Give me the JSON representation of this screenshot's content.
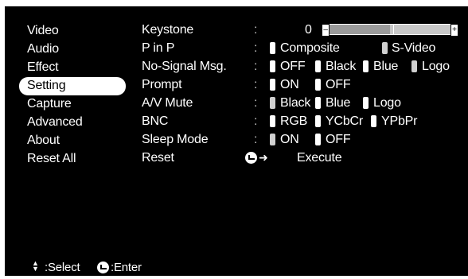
{
  "menu": {
    "items": [
      {
        "label": "Video"
      },
      {
        "label": "Audio"
      },
      {
        "label": "Effect"
      },
      {
        "label": "Setting",
        "selected": true
      },
      {
        "label": "Capture"
      },
      {
        "label": "Advanced"
      },
      {
        "label": "About"
      },
      {
        "label": "Reset All"
      }
    ]
  },
  "settings": {
    "keystone": {
      "label": "Keystone",
      "value": "0",
      "level_percent": 50
    },
    "pinp": {
      "label": "P in P",
      "options": [
        "Composite",
        "S-Video"
      ]
    },
    "no_signal": {
      "label": "No-Signal Msg.",
      "options": [
        "OFF",
        "Black",
        "Blue",
        "Logo"
      ]
    },
    "prompt": {
      "label": "Prompt",
      "options": [
        "ON",
        "OFF"
      ]
    },
    "av_mute": {
      "label": "A/V Mute",
      "options": [
        "Black",
        "Blue",
        "Logo"
      ]
    },
    "bnc": {
      "label": "BNC",
      "options": [
        "RGB",
        "YCbCr",
        "YPbPr"
      ]
    },
    "sleep": {
      "label": "Sleep Mode",
      "options": [
        "ON",
        "OFF"
      ]
    },
    "reset": {
      "label": "Reset",
      "action": "Execute"
    }
  },
  "colon": ":",
  "footer": {
    "select_label": ":Select",
    "enter_label": ":Enter"
  },
  "icons": {
    "updown": "updown-arrow-icon",
    "enter": "enter-icon"
  },
  "colors": {
    "background": "#000000",
    "text": "#ffffff",
    "highlight": "#ffffff"
  }
}
